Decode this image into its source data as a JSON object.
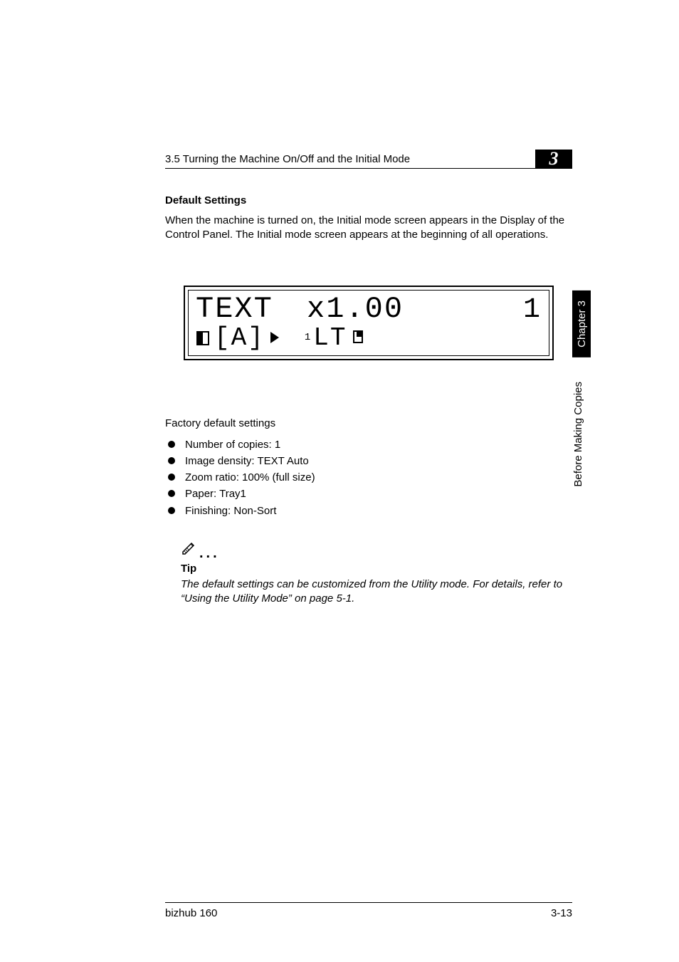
{
  "header": {
    "section": "3.5 Turning the Machine On/Off and the Initial Mode",
    "chapter_num": "3"
  },
  "subheading": "Default Settings",
  "intro": "When the machine is turned on, the Initial mode screen appears in the Display of the Control Panel. The Initial mode screen appears at the beginning of all operations.",
  "lcd": {
    "line1_left": "TEXT",
    "line1_mid": "x1.00",
    "line1_right": "1",
    "line2_bracket": "[A]",
    "line2_sup": "1",
    "line2_size": "LT"
  },
  "factory_heading": "Factory default settings",
  "settings": [
    "Number of copies: 1",
    "Image density: TEXT Auto",
    "Zoom ratio: 100% (full size)",
    "Paper: Tray1",
    "Finishing: Non-Sort"
  ],
  "tip": {
    "label": "Tip",
    "text": "The default settings can be customized from the Utility mode. For details, refer to “Using the Utility Mode” on page 5-1."
  },
  "footer": {
    "product": "bizhub 160",
    "page": "3-13"
  },
  "sidebar": {
    "chapter_tab": "Chapter 3",
    "section_tab": "Before Making Copies"
  }
}
